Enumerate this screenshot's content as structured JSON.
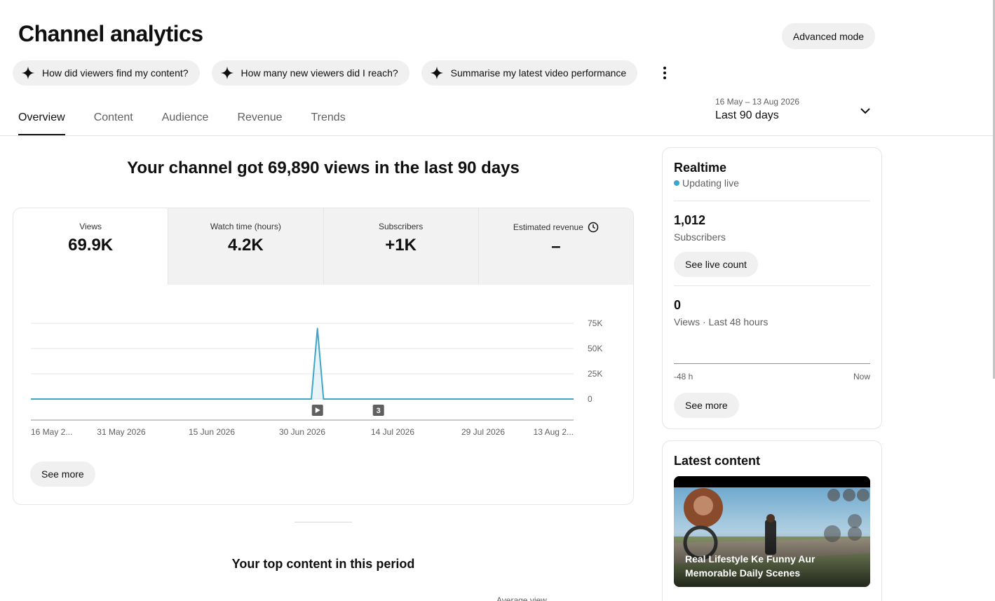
{
  "header": {
    "title": "Channel analytics",
    "advanced_mode_label": "Advanced mode"
  },
  "suggestions": [
    {
      "label": "How did viewers find my content?"
    },
    {
      "label": "How many new viewers did I reach?"
    },
    {
      "label": "Summarise my latest video performance"
    }
  ],
  "tabs": [
    {
      "label": "Overview",
      "active": true
    },
    {
      "label": "Content",
      "active": false
    },
    {
      "label": "Audience",
      "active": false
    },
    {
      "label": "Revenue",
      "active": false
    },
    {
      "label": "Trends",
      "active": false
    }
  ],
  "date_range": {
    "dates": "16 May – 13 Aug 2026",
    "label": "Last 90 days"
  },
  "overview": {
    "headline": "Your channel got 69,890 views in the last 90 days",
    "metrics": [
      {
        "label": "Views",
        "value": "69.9K"
      },
      {
        "label": "Watch time (hours)",
        "value": "4.2K"
      },
      {
        "label": "Subscribers",
        "value": "+1K"
      },
      {
        "label": "Estimated revenue",
        "value": "–"
      }
    ],
    "see_more_label": "See more"
  },
  "chart_data": {
    "type": "area",
    "x_tick_labels": [
      "16 May 2...",
      "31 May 2026",
      "15 Jun 2026",
      "30 Jun 2026",
      "14 Jul 2026",
      "29 Jul 2026",
      "13 Aug 2..."
    ],
    "y_tick_labels": [
      "75K",
      "50K",
      "25K",
      "0"
    ],
    "ylim": [
      0,
      75000
    ],
    "days": 90,
    "series": [
      {
        "points": [
          {
            "day_index": 0,
            "value": 0
          },
          {
            "day_index": 46,
            "value": 0
          },
          {
            "day_index": 47,
            "value": 69890
          },
          {
            "day_index": 48,
            "value": 0
          },
          {
            "day_index": 89,
            "value": 0
          }
        ]
      }
    ],
    "markers": [
      {
        "day_index": 47,
        "type": "video-upload"
      },
      {
        "day_index": 57,
        "type": "count",
        "label": "3"
      }
    ],
    "color": "#3ea6c9",
    "grid": true
  },
  "realtime": {
    "title": "Realtime",
    "status": "Updating live",
    "subscribers_value": "1,012",
    "subscribers_label": "Subscribers",
    "see_live_count_label": "See live count",
    "views_value": "0",
    "views_label": "Views · Last 48 hours",
    "axis_start": "-48 h",
    "axis_end": "Now",
    "see_more_label": "See more"
  },
  "latest_content": {
    "title": "Latest content",
    "video_title": "Real Lifestyle Ke Funny Aur Memorable Daily Scenes"
  },
  "top_content": {
    "title": "Your top content in this period",
    "column_label": "Average view"
  }
}
